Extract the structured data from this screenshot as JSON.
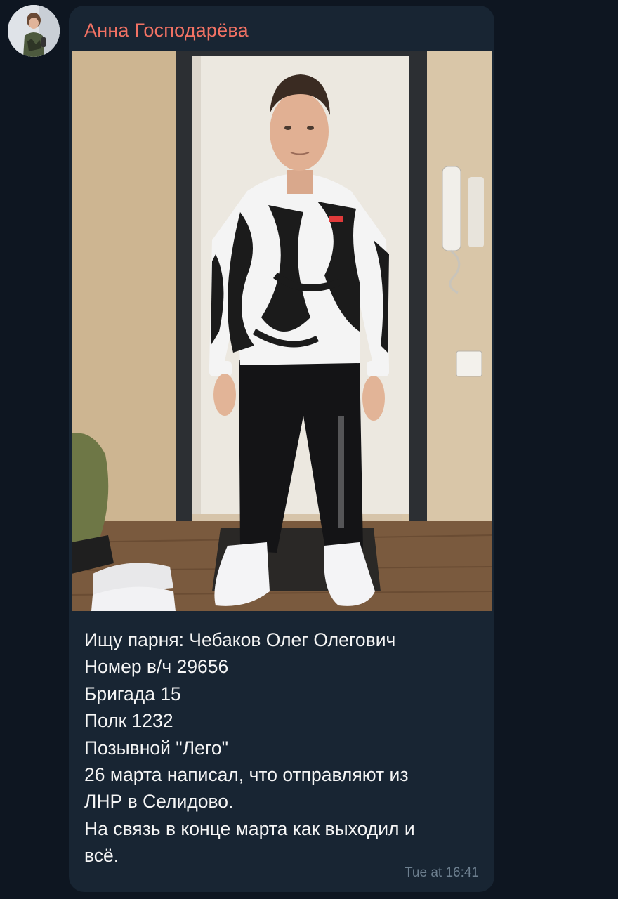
{
  "message": {
    "sender_name": "Анна Господарёва",
    "text_lines": [
      "Ищу парня: Чебаков Олег Олегович",
      "Номер в/ч 29656",
      "Бригада 15",
      "Полк 1232",
      "Позывной \"Лего\"",
      "26 марта написал, что отправляют из",
      "ЛНР в Селидово.",
      "На связь в конце марта как выходил и",
      "всё."
    ],
    "timestamp": "Tue at 16:41"
  },
  "colors": {
    "background": "#0e1621",
    "bubble": "#182533",
    "sender_name": "#f27264",
    "text": "#f5f5f5",
    "timestamp": "#6d7f8f"
  }
}
